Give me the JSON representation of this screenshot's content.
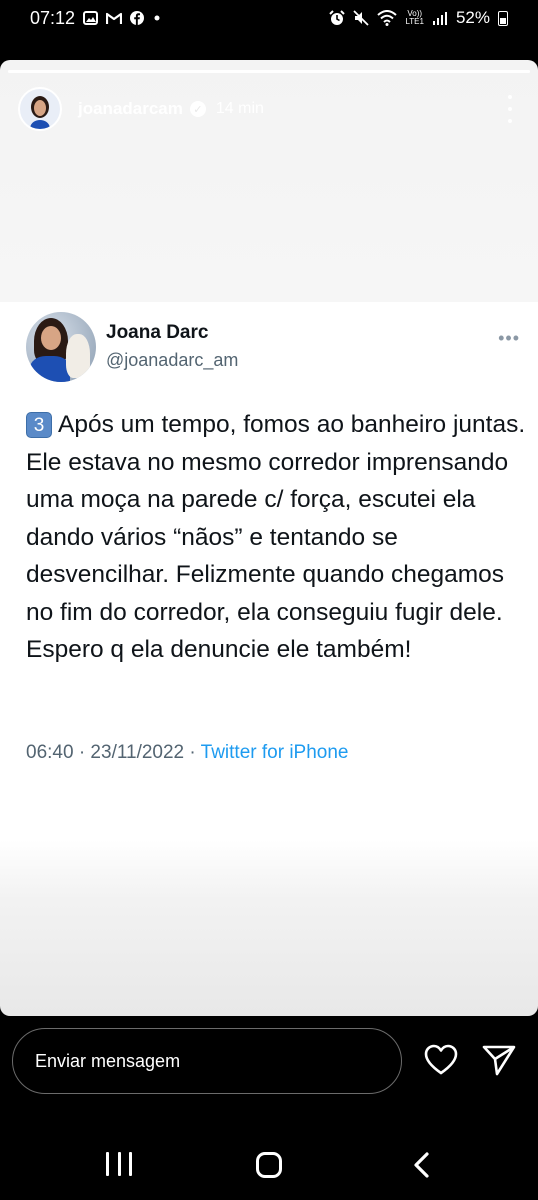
{
  "status_bar": {
    "time": "07:12",
    "notification_icons": [
      "image-icon",
      "gmail-icon",
      "facebook-icon",
      "dot-icon"
    ],
    "system_icons": [
      "alarm-icon",
      "mute-icon",
      "wifi-icon",
      "volte-icon",
      "signal-icon"
    ],
    "volte_top": "Vo))",
    "volte_bottom": "LTE1",
    "battery": "52%"
  },
  "story": {
    "progress": 1.0,
    "username": "joanadarcam",
    "verified": true,
    "time_ago": "14 min"
  },
  "tweet": {
    "name": "Joana Darc",
    "handle": "@joanadarc_am",
    "more": "•••",
    "keycap": "3",
    "text": "Após um tempo, fomos ao banheiro juntas. Ele estava no mesmo corredor imprensando uma moça na parede c/ força, escutei ela dando vários “nãos” e tentando se desvencilhar. Felizmente quando chegamos no fim do corredor, ela conseguiu fugir dele. Espero q ela denuncie ele também!",
    "timestamp": "06:40 · 23/11/2022 · ",
    "source": "Twitter for iPhone"
  },
  "reply": {
    "placeholder": "Enviar mensagem",
    "like_icon": "heart-icon",
    "send_icon": "send-icon"
  },
  "nav": {
    "recents_icon": "recents-icon",
    "home_icon": "home-icon",
    "back_icon": "back-icon"
  },
  "colors": {
    "twitter_blue": "#1d9bf0",
    "handle_gray": "#536471",
    "keycap_blue": "#5a8ac8"
  }
}
